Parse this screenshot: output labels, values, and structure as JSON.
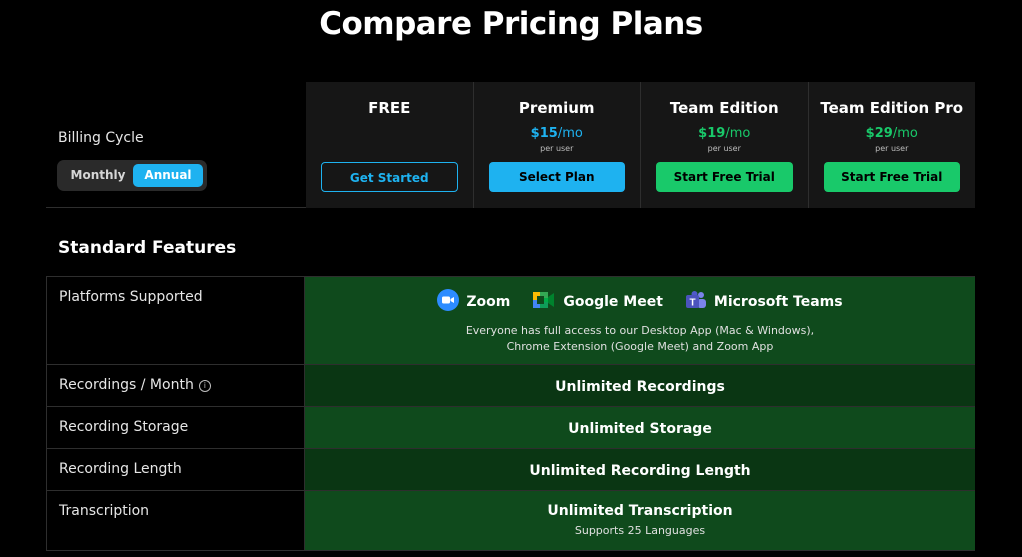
{
  "page_title": "Compare Pricing Plans",
  "billing": {
    "label": "Billing Cycle",
    "options": [
      "Monthly",
      "Annual"
    ],
    "selected": "Annual"
  },
  "plans": [
    {
      "name": "FREE",
      "price": "",
      "unit": "",
      "per": "",
      "button": "Get Started",
      "button_style": "outline-blue"
    },
    {
      "name": "Premium",
      "price": "$15",
      "unit": "/mo",
      "per": "per user",
      "button": "Select Plan",
      "button_style": "blue",
      "price_color": "#1eb2f0"
    },
    {
      "name": "Team Edition",
      "price": "$19",
      "unit": "/mo",
      "per": "per user",
      "button": "Start Free Trial",
      "button_style": "green",
      "price_color": "#19c96a"
    },
    {
      "name": "Team Edition Pro",
      "price": "$29",
      "unit": "/mo",
      "per": "per user",
      "button": "Start Free Trial",
      "button_style": "green",
      "price_color": "#19c96a"
    }
  ],
  "section_title": "Standard Features",
  "features": {
    "platforms": {
      "label": "Platforms Supported",
      "items": [
        {
          "name": "Zoom",
          "icon": "zoom-icon"
        },
        {
          "name": "Google Meet",
          "icon": "google-meet-icon"
        },
        {
          "name": "Microsoft Teams",
          "icon": "microsoft-teams-icon"
        }
      ],
      "note_line1": "Everyone has full access to our Desktop App (Mac & Windows),",
      "note_line2": "Chrome Extension (Google Meet) and Zoom App"
    },
    "recordings": {
      "label": "Recordings / Month",
      "value": "Unlimited Recordings"
    },
    "storage": {
      "label": "Recording Storage",
      "value": "Unlimited Storage"
    },
    "length": {
      "label": "Recording Length",
      "value": "Unlimited Recording Length"
    },
    "transcription": {
      "label": "Transcription",
      "value": "Unlimited Transcription",
      "sub": "Supports 25 Languages"
    }
  },
  "colors": {
    "blue": "#1eb2f0",
    "green": "#19c96a",
    "row_green_a": "#0f4a1c",
    "row_green_b": "#0a3613"
  }
}
